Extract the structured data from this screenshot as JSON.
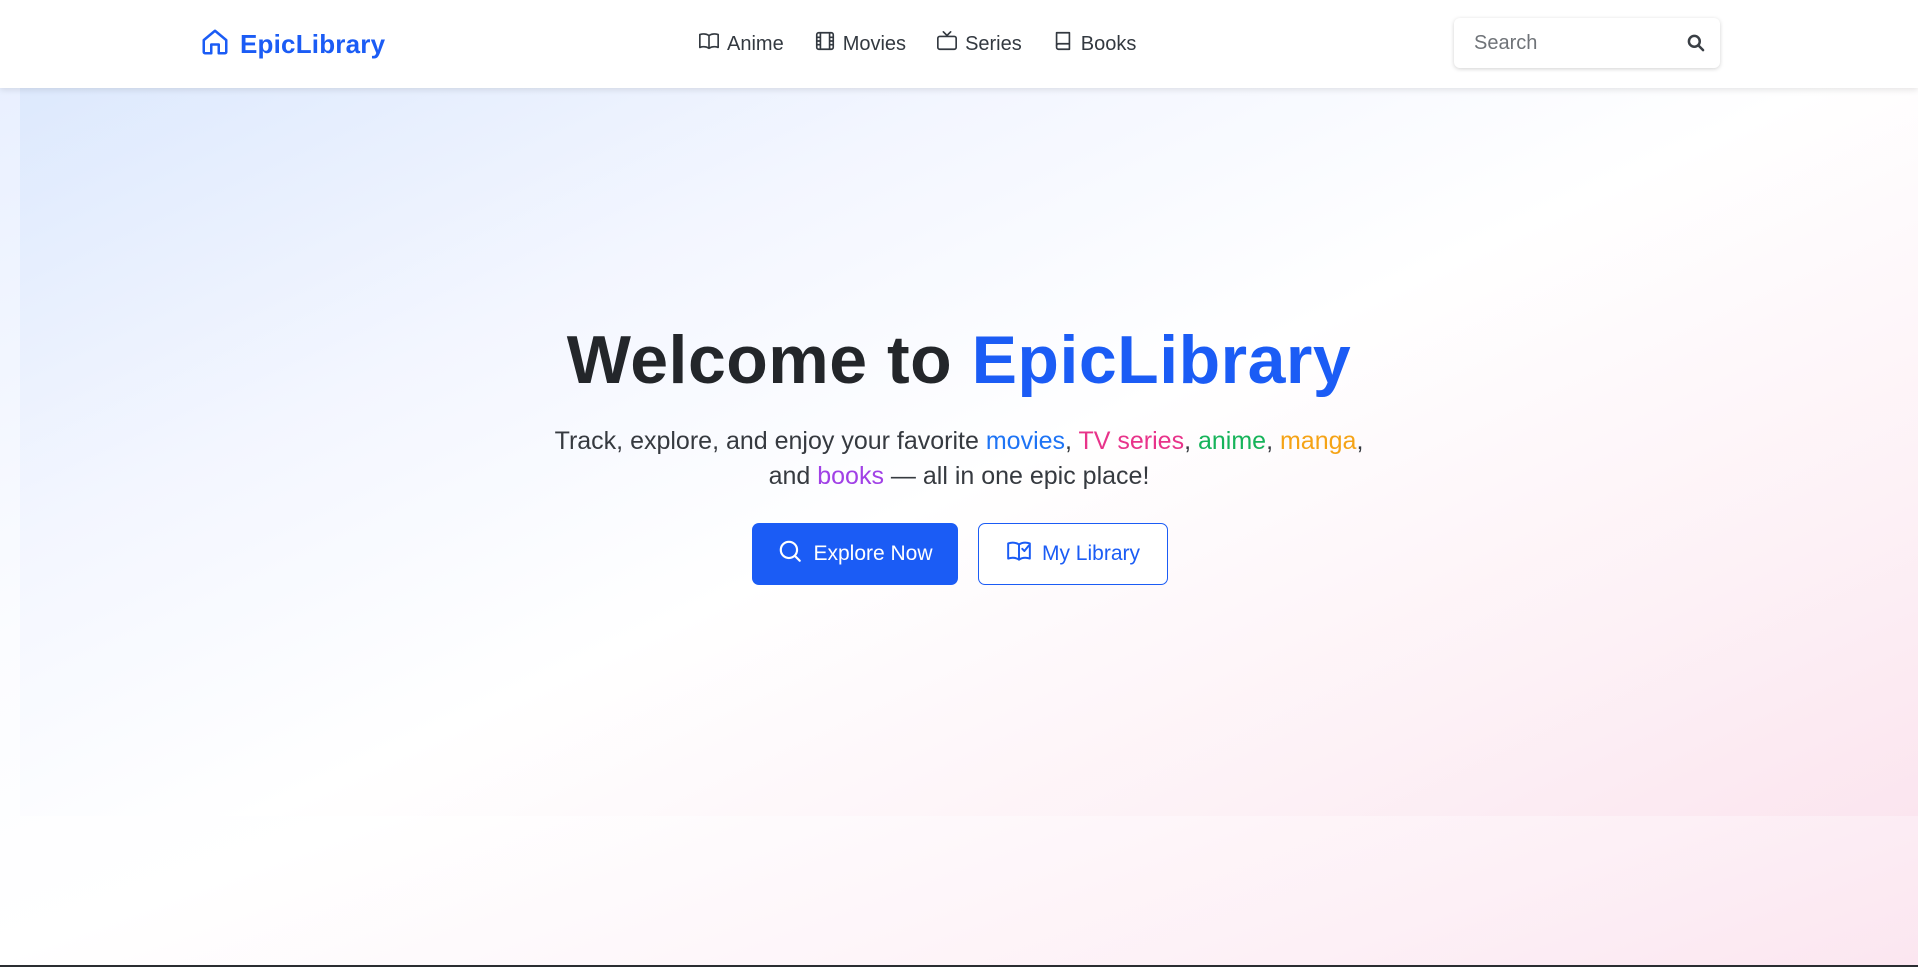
{
  "brand": {
    "name": "EpicLibrary",
    "icon": "home-icon",
    "color": "#1b5cf5"
  },
  "nav": {
    "items": [
      {
        "label": "Anime",
        "icon": "open-book-icon"
      },
      {
        "label": "Movies",
        "icon": "film-icon"
      },
      {
        "label": "Series",
        "icon": "tv-icon"
      },
      {
        "label": "Books",
        "icon": "book-icon"
      }
    ]
  },
  "search": {
    "placeholder": "Search",
    "value": "",
    "icon": "search-icon"
  },
  "hero": {
    "title_prefix": "Welcome to ",
    "title_accent": "EpicLibrary",
    "subtitle": {
      "part1": "Track, explore, and enjoy your favorite ",
      "movies": "movies",
      "sep1": ", ",
      "tv_series": "TV series",
      "sep2": ", ",
      "anime": "anime",
      "sep3": ", ",
      "manga": "manga",
      "sep4": ",",
      "part2": " and ",
      "books": "books",
      "part3": " — all in one epic place!"
    },
    "primary_button": {
      "label": "Explore Now",
      "icon": "search-icon"
    },
    "secondary_button": {
      "label": "My Library",
      "icon": "book-check-icon"
    }
  },
  "colors": {
    "accent": "#1b5cf5",
    "movies": "#1e74f5",
    "tv_series": "#e8338a",
    "anime": "#16b35a",
    "manga": "#f5a315",
    "books": "#a141e6"
  }
}
